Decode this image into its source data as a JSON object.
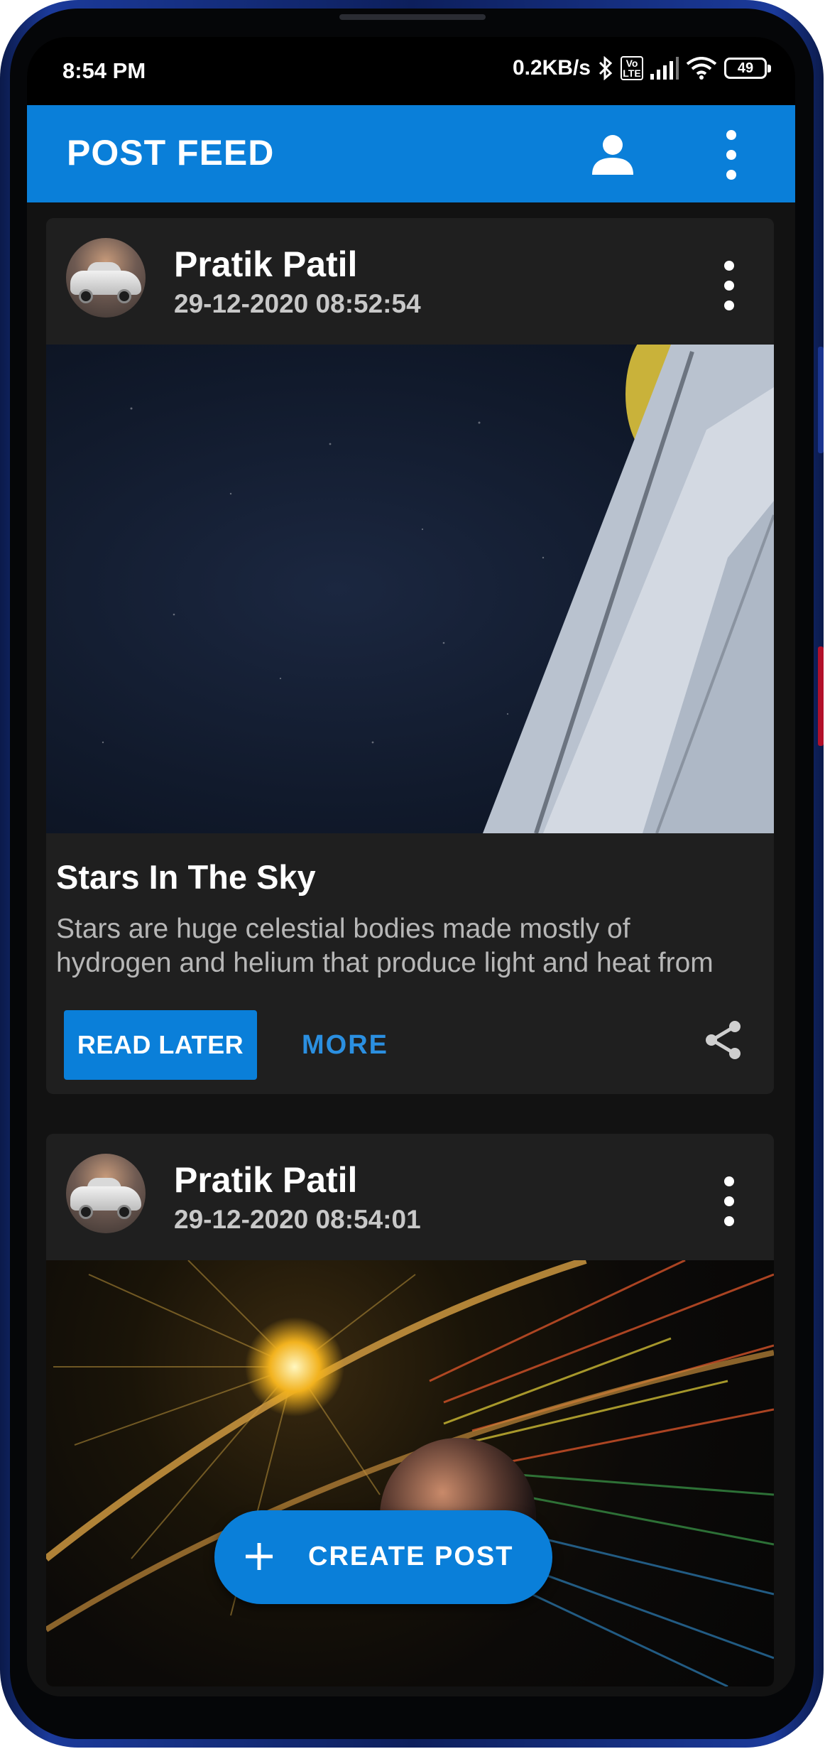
{
  "status_bar": {
    "time": "8:54 PM",
    "net_speed": "0.2KB/s",
    "volte": "Vo LTE",
    "battery": "49",
    "icons": [
      "bluetooth-icon",
      "volte-icon",
      "signal-icon",
      "wifi-icon",
      "battery-icon"
    ]
  },
  "app_bar": {
    "title": "POST FEED",
    "actions": [
      "profile-icon",
      "overflow-menu-icon"
    ]
  },
  "posts": [
    {
      "author": "Pratik Patil",
      "timestamp": "29-12-2020 08:52:54",
      "title": "Stars In The Sky",
      "body": "Stars are huge celestial bodies made mostly of hydrogen and helium that produce light and heat from",
      "actions": {
        "read_later": "READ LATER",
        "more": "MORE"
      }
    },
    {
      "author": "Pratik Patil",
      "timestamp": "29-12-2020 08:54:01"
    }
  ],
  "fab": {
    "label": "CREATE POST"
  },
  "colors": {
    "primary": "#0a7fd9",
    "card": "#1f1f1f",
    "background": "#121212",
    "accent_text": "#2b8fe0"
  }
}
